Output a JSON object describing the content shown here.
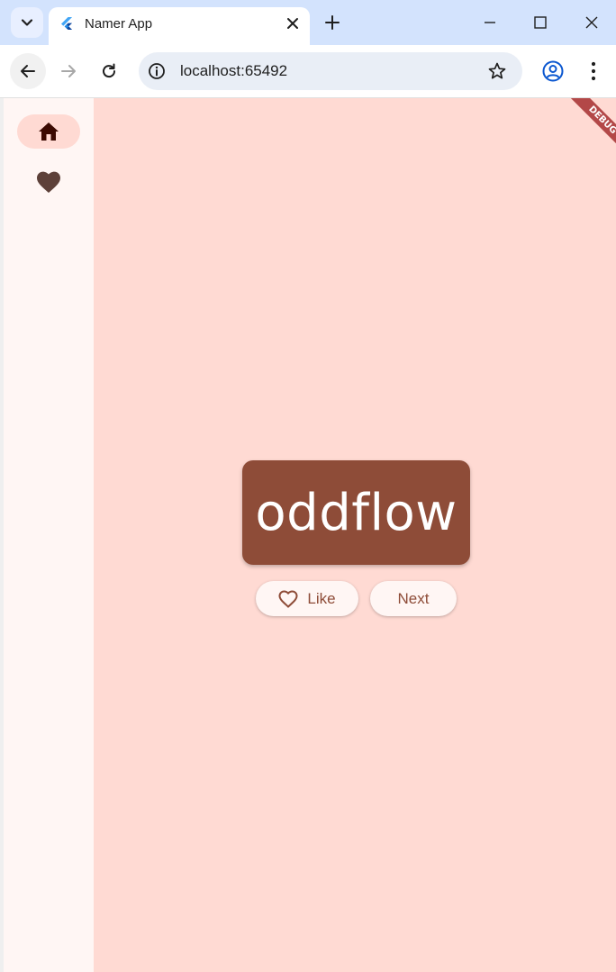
{
  "browser": {
    "tab_title": "Namer App",
    "url": "localhost:65492",
    "icons": {
      "tab_search": "chevron-down-icon",
      "favicon": "flutter-icon",
      "tab_close": "close-icon",
      "new_tab": "plus-icon",
      "minimize": "minimize-icon",
      "maximize": "maximize-icon",
      "window_close": "close-icon",
      "back": "arrow-left-icon",
      "forward": "arrow-right-icon",
      "reload": "reload-icon",
      "site_info": "info-icon",
      "bookmark": "star-icon",
      "profile": "profile-icon",
      "menu": "kebab-menu-icon"
    }
  },
  "app": {
    "debug_banner": "DEBUG",
    "rail": {
      "items": [
        {
          "icon": "home-icon",
          "selected": true
        },
        {
          "icon": "heart-icon",
          "selected": false
        }
      ]
    },
    "word_pair": "oddflow",
    "like_label": "Like",
    "next_label": "Next",
    "colors": {
      "background": "#ffdad3",
      "rail_background": "#fff6f4",
      "card": "#8e4c38",
      "card_text": "#ffffff",
      "button_text": "#8e4c38",
      "debug_ribbon": "#b34848"
    }
  }
}
